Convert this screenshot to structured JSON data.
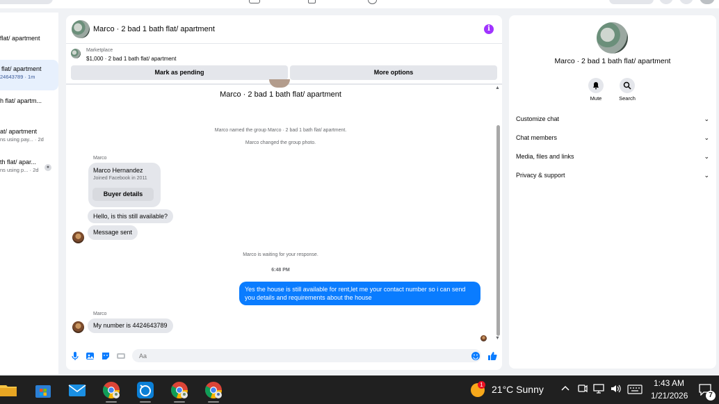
{
  "left_list": {
    "items": [
      {
        "title": "flat/ apartment",
        "sub": ""
      },
      {
        "title": "flat/ apartment",
        "sub": "24643789 · 1m"
      },
      {
        "title": "h flat/ apartm...",
        "sub": ""
      },
      {
        "title": "at/ apartment",
        "sub": "ns using pay...  · 2d"
      },
      {
        "title": "th flat/ apar...",
        "sub": "ns using p...  · 2d"
      }
    ]
  },
  "chat": {
    "header_title": "Marco · 2 bad 1 bath flat/ apartment",
    "marketplace_label": "Marketplace",
    "listing_line": "$1,000 · 2 bad 1 bath flat/ apartment",
    "mark_pending_label": "Mark as pending",
    "more_options_label": "More options",
    "group_title": "Marco · 2 bad 1 bath flat/ apartment",
    "system_messages": [
      "Marco named the group Marco · 2 bad 1 bath flat/ apartment.",
      "Marco changed the group photo.",
      "Marco is waiting for your response."
    ],
    "sender_name": "Marco",
    "buyer_card": {
      "name": "Marco Hernandez",
      "joined": "Joined Facebook in 2011",
      "button": "Buyer details"
    },
    "incoming": [
      "Hello, is this still available?",
      "Message sent",
      "My number is 4424643789"
    ],
    "timestamp": "6:48 PM",
    "outgoing": "Yes the house is still available for rent,let me your contact number so i can send you details and requirements about the house",
    "composer_placeholder": "Aa"
  },
  "right_panel": {
    "title": "Marco · 2 bad 1 bath flat/ apartment",
    "actions": [
      {
        "label": "Mute",
        "icon": "bell-icon"
      },
      {
        "label": "Search",
        "icon": "search-icon"
      }
    ],
    "sections": [
      "Customize chat",
      "Chat members",
      "Media, files and links",
      "Privacy & support"
    ]
  },
  "taskbar": {
    "weather_badge": "1",
    "weather_text": "21°C  Sunny",
    "time": "1:43 AM",
    "date": "1/21/2026",
    "notification_count": "7"
  },
  "colors": {
    "accent_blue": "#0a7cff",
    "info_purple": "#a033ff",
    "taskbar": "#202020"
  }
}
